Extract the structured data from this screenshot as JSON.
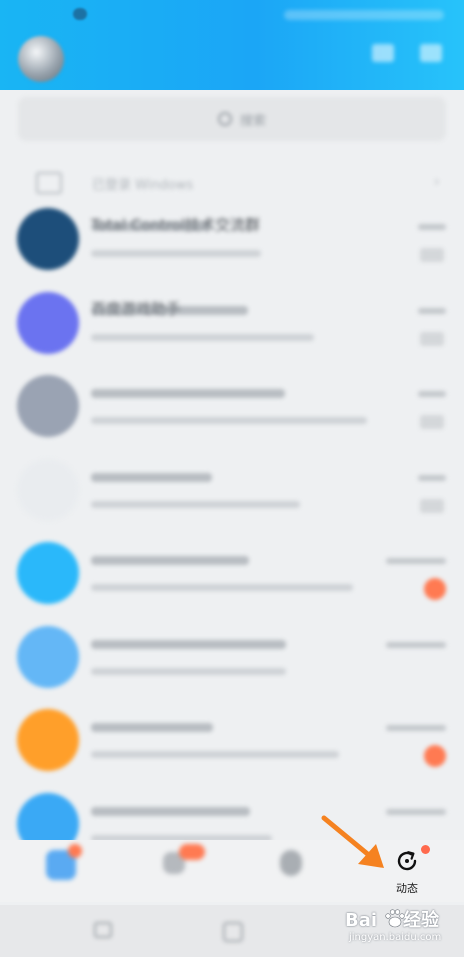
{
  "header": {
    "avatar_icon": "profile-avatar",
    "right_icons": [
      "add-icon",
      "more-icon"
    ]
  },
  "search": {
    "label": "搜索"
  },
  "device_row": {
    "label": "已登录 Windows"
  },
  "chats": [
    {
      "name": "Total Control技术交流群",
      "preview": "",
      "time": "",
      "avatar_color": "#1d4e7a",
      "indicator": "meta"
    },
    {
      "name": "百度游戏助手",
      "preview": "",
      "time": "",
      "avatar_color": "#6b73f0",
      "indicator": "meta"
    },
    {
      "name": "",
      "preview": "",
      "time": "",
      "avatar_color": "#9aa3b3",
      "indicator": "meta"
    },
    {
      "name": "",
      "preview": "",
      "time": "",
      "avatar_color": "#e9ecef",
      "indicator": "meta"
    },
    {
      "name": "",
      "preview": "",
      "time": "",
      "avatar_color": "#2ab8fa",
      "indicator": "badge"
    },
    {
      "name": "",
      "preview": "",
      "time": "",
      "avatar_color": "#64b7f6",
      "indicator": "none"
    },
    {
      "name": "",
      "preview": "",
      "time": "",
      "avatar_color": "#ff9f2a",
      "indicator": "badge"
    },
    {
      "name": "",
      "preview": "",
      "time": "",
      "avatar_color": "#3aa9f5",
      "indicator": "none"
    }
  ],
  "tabbar": {
    "dynamic_label": "动态",
    "dynamic_icon": "refresh-icon",
    "accent": "#ff6a4d"
  },
  "watermark": {
    "brand": "Bai",
    "brand_suffix": "经验",
    "url": "jingyan.baidu.com"
  },
  "colors": {
    "header": "#1ba6f6",
    "arrow": "#f58220",
    "badge": "#ff7a52"
  }
}
